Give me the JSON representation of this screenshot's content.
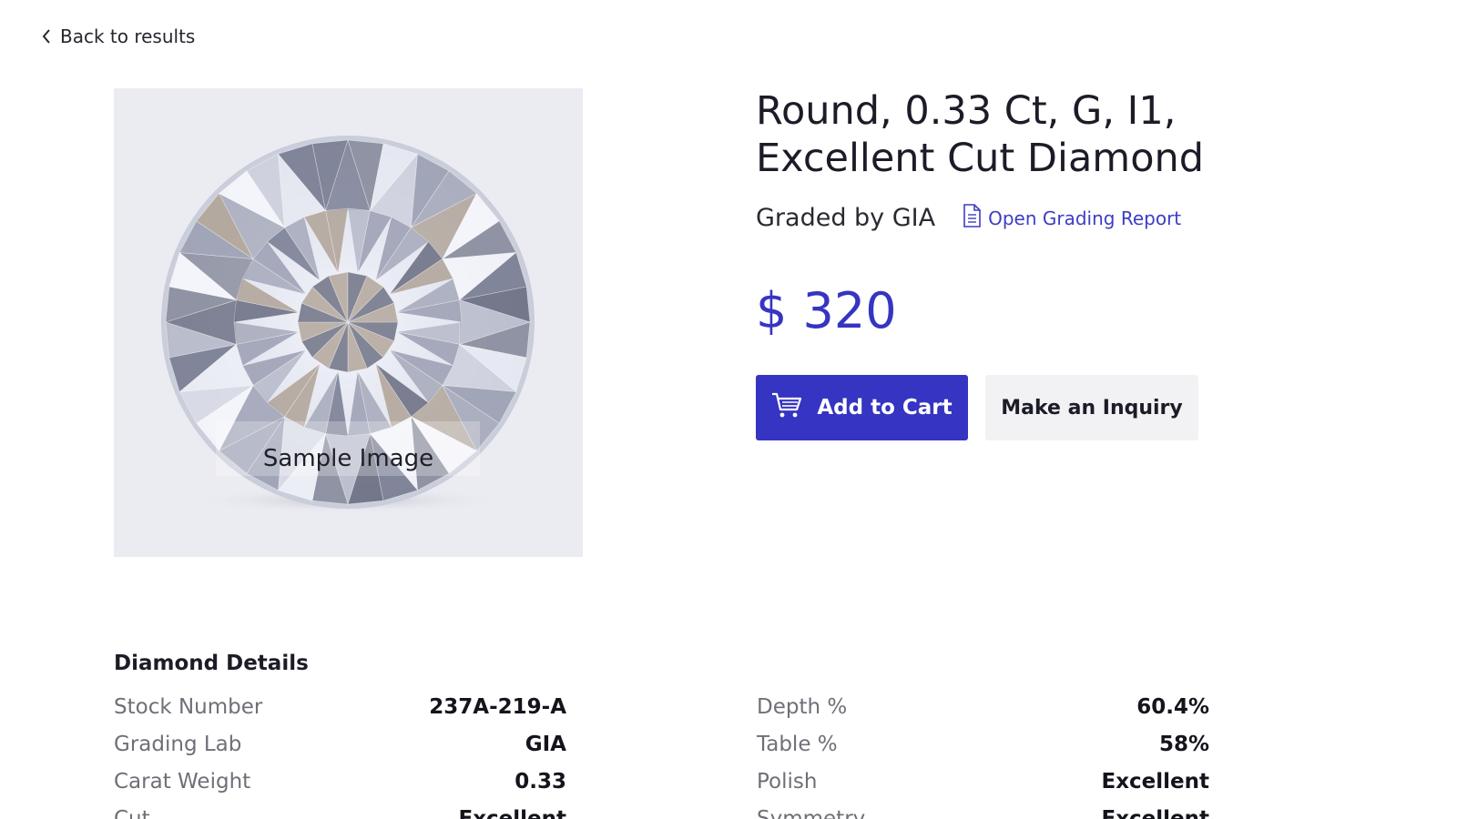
{
  "nav": {
    "back_label": "Back to results",
    "back_icon": "chevron-left-icon"
  },
  "product": {
    "title": "Round, 0.33 Ct, G, I1, Excellent Cut Diamond",
    "image_caption": "Sample Image",
    "graded_by": "Graded by GIA",
    "report_link_label": "Open Grading Report",
    "report_icon": "document-icon",
    "price": "$ 320"
  },
  "actions": {
    "add_to_cart_label": "Add to Cart",
    "cart_icon": "cart-icon",
    "inquiry_label": "Make an Inquiry"
  },
  "details": {
    "heading": "Diamond Details",
    "left": [
      {
        "label": "Stock Number",
        "value": "237A-219-A"
      },
      {
        "label": "Grading Lab",
        "value": "GIA"
      },
      {
        "label": "Carat Weight",
        "value": "0.33"
      },
      {
        "label": "Cut",
        "value": "Excellent"
      }
    ],
    "right": [
      {
        "label": "Depth %",
        "value": "60.4%"
      },
      {
        "label": "Table %",
        "value": "58%"
      },
      {
        "label": "Polish",
        "value": "Excellent"
      },
      {
        "label": "Symmetry",
        "value": "Excellent"
      }
    ]
  },
  "colors": {
    "accent": "#3534c3",
    "price": "#3535c2",
    "link": "#3d3dc4",
    "image_background": "#ebebf2",
    "secondary_button": "#f2f2f4"
  }
}
